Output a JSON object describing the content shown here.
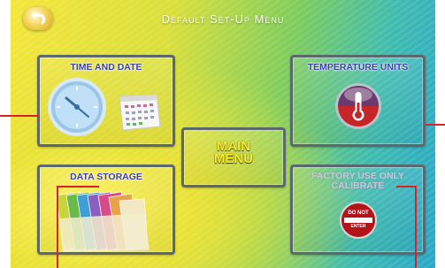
{
  "screen": {
    "title": "Default Set-Up Menu"
  },
  "panels": {
    "time_date": {
      "label": "TIME AND DATE"
    },
    "temperature": {
      "label": "TEMPERATURE UNITS"
    },
    "data_storage": {
      "label": "DATA STORAGE"
    },
    "main_menu": {
      "line1": "MAIN",
      "line2": "MENU"
    },
    "factory": {
      "line1": "FACTORY USE ONLY",
      "line2": "CALIBRATE"
    }
  },
  "sign": {
    "top": "DO NOT",
    "bottom": "ENTER"
  },
  "icons": [
    "back-arrow-icon",
    "clock-icon",
    "calendar-icon",
    "thermometer-icon",
    "folders-icon",
    "do-not-enter-icon"
  ],
  "colors": {
    "label": "#3b3fa8",
    "main_menu": "#f7ef2a",
    "panel_border": "#5c6870",
    "leader_line": "#d8232a"
  }
}
